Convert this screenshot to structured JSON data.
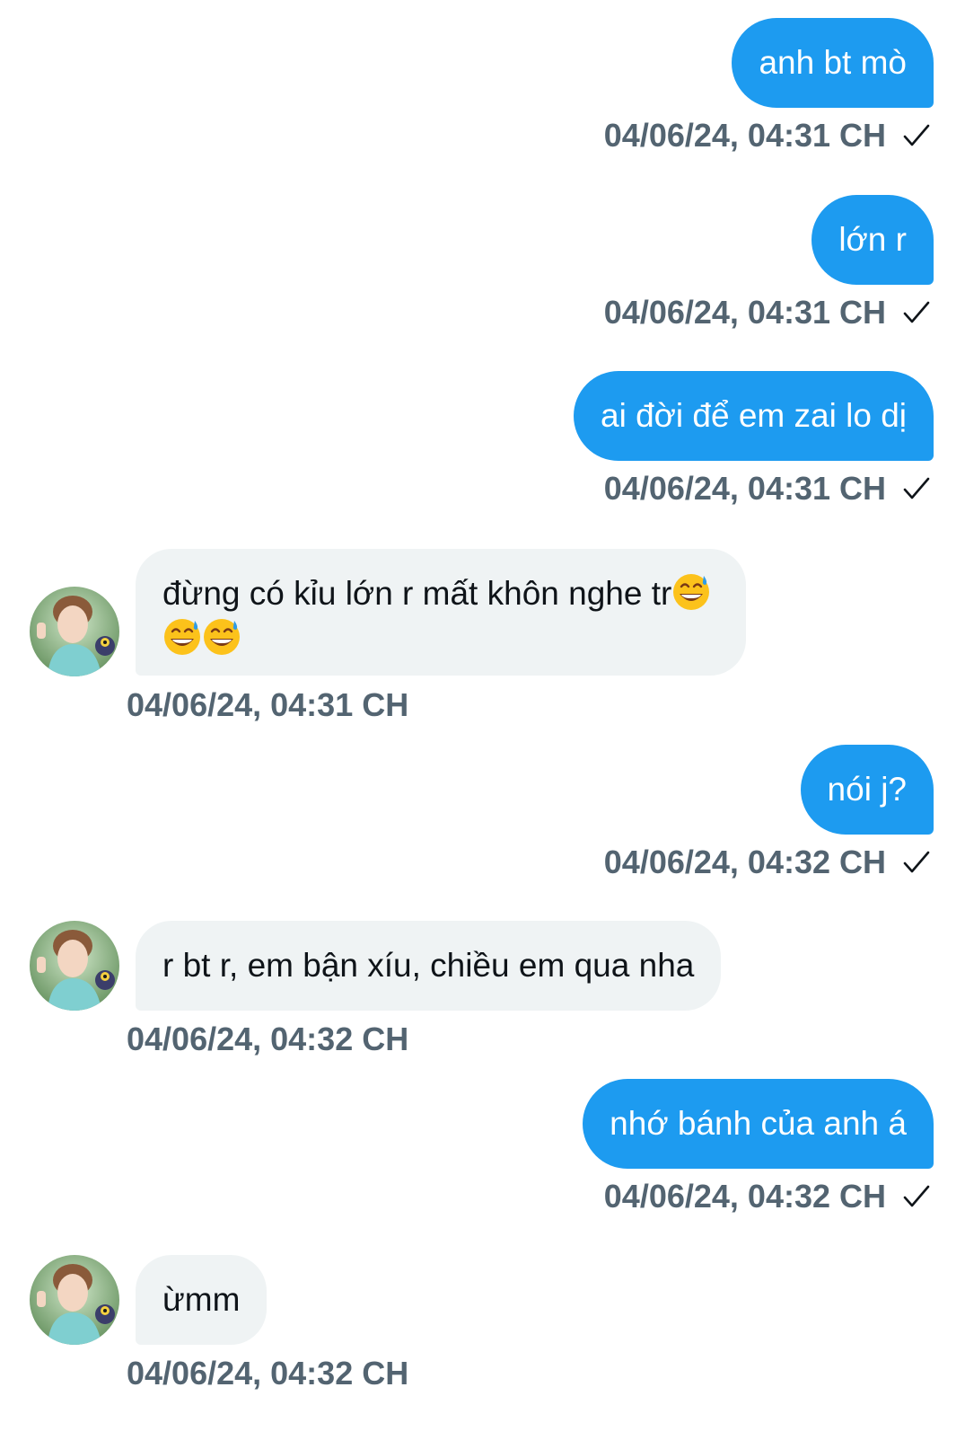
{
  "conversation": {
    "messages": [
      {
        "direction": "out",
        "text": "anh bt mò",
        "timestamp": "04/06/24, 04:31 CH",
        "read_icon": "checkmark-icon"
      },
      {
        "direction": "out",
        "text": "lớn r",
        "timestamp": "04/06/24, 04:31 CH",
        "read_icon": "checkmark-icon"
      },
      {
        "direction": "out",
        "text": "ai đời để em zai lo dị",
        "timestamp": "04/06/24, 04:31 CH",
        "read_icon": "checkmark-icon"
      },
      {
        "direction": "in",
        "line1": "đừng có kỉu lớn r mất khôn nghe tr",
        "emoji": "grinning-sweat-emoji",
        "emoji_count": 3,
        "timestamp": "04/06/24, 04:31 CH"
      },
      {
        "direction": "out",
        "text": "nói j?",
        "timestamp": "04/06/24, 04:32 CH",
        "read_icon": "checkmark-icon"
      },
      {
        "direction": "in",
        "text": "r bt r, em bận xíu, chiều em qua nha",
        "timestamp": "04/06/24, 04:32 CH"
      },
      {
        "direction": "out",
        "text": "nhớ bánh của anh á",
        "timestamp": "04/06/24, 04:32 CH",
        "read_icon": "checkmark-icon"
      },
      {
        "direction": "in",
        "text": "ừmm",
        "timestamp": "04/06/24, 04:32 CH"
      }
    ]
  },
  "colors": {
    "outgoing_bubble": "#1d9bf0",
    "incoming_bubble": "#eff3f4",
    "timestamp_text": "#536471",
    "incoming_text": "#0f1419"
  }
}
